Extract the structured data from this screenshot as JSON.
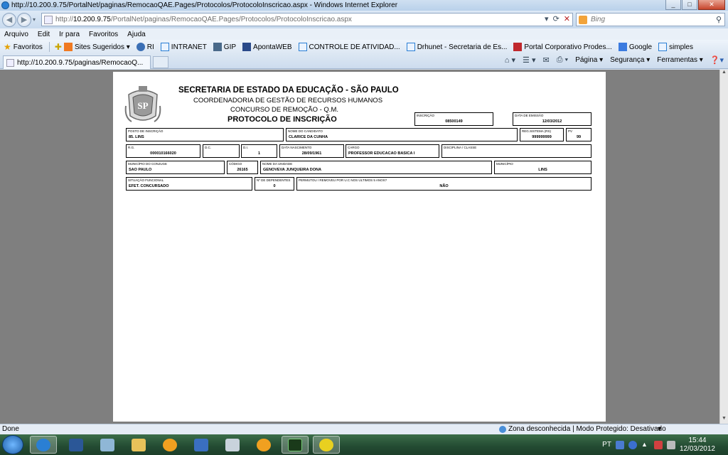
{
  "window": {
    "title": "http://10.200.9.75/PortalNet/paginas/RemocaoQAE.Pages/Protocolos/ProtocoloInscricao.aspx - Windows Internet Explorer"
  },
  "address": {
    "url_prefix": "http://",
    "url_host": "10.200.9.75",
    "url_path": "/PortalNet/paginas/RemocaoQAE.Pages/Protocolos/ProtocoloInscricao.aspx",
    "search_placeholder": "Bing"
  },
  "menu": [
    "Arquivo",
    "Edit",
    "Ir para",
    "Favoritos",
    "Ajuda"
  ],
  "favorites": {
    "label": "Favoritos",
    "items": [
      {
        "label": "Sites Sugeridos ▾",
        "icon": "suggested-sites-icon",
        "color": "#f07a22"
      },
      {
        "label": "RI",
        "icon": "ri-icon",
        "color": "#3b6fb5"
      },
      {
        "label": "INTRANET",
        "icon": "ie-page-icon",
        "color": "#2a7fd4"
      },
      {
        "label": "GIP",
        "icon": "gip-icon",
        "color": "#4a6a8a"
      },
      {
        "label": "ApontaWEB",
        "icon": "apontaweb-icon",
        "color": "#2a4a8a"
      },
      {
        "label": "CONTROLE DE ATIVIDAD...",
        "icon": "ie-page-icon",
        "color": "#2a7fd4"
      },
      {
        "label": "Drhunet - Secretaria de Es...",
        "icon": "ie-page-icon",
        "color": "#2a7fd4"
      },
      {
        "label": "Portal Corporativo Prodes...",
        "icon": "portal-icon",
        "color": "#c0282d"
      },
      {
        "label": "Google",
        "icon": "google-icon",
        "color": "#3b7be0"
      },
      {
        "label": "simples",
        "icon": "ie-page-icon",
        "color": "#2a7fd4"
      }
    ]
  },
  "tab": {
    "label": "http://10.200.9.75/paginas/RemocaoQ..."
  },
  "commandbar": {
    "page": "Página ▾",
    "security": "Segurança ▾",
    "tools": "Ferramentas ▾"
  },
  "document": {
    "title1": "SECRETARIA DE ESTADO DA EDUCAÇÃO - SÃO PAULO",
    "title2": "COORDENADORIA DE GESTÃO DE RECURSOS HUMANOS",
    "title3": "CONCURSO DE REMOÇÃO - Q.M.",
    "title4": "PROTOCOLO DE INSCRIÇÃO",
    "logo_text": "SP",
    "fields": {
      "inscricao": {
        "label": "INSCRIÇÃO",
        "value": "08500149"
      },
      "data_emissao": {
        "label": "DATA DE EMISSÃO",
        "value": "12/03/2012"
      },
      "posto": {
        "label": "POSTO DE INSCRIÇÃO",
        "value": "85. LINS"
      },
      "candidato": {
        "label": "NOME DO CANDIDATO",
        "value": "CLARICE DA CUNHA"
      },
      "reg_sistema": {
        "label": "REG.SISTEMA (RS)",
        "value": "999999999"
      },
      "pv": {
        "label": "PV",
        "value": "99"
      },
      "rg": {
        "label": "R.G.",
        "value": "000010166020"
      },
      "dc": {
        "label": "D.C.",
        "value": ""
      },
      "di": {
        "label": "D.I.",
        "value": "1"
      },
      "nascimento": {
        "label": "DATA NASCIMENTO",
        "value": "28/09/1961"
      },
      "cargo": {
        "label": "CARGO",
        "value": "PROFESSOR EDUCACAO BASICA I"
      },
      "disciplina": {
        "label": "DISCIPLINA / CLASSE",
        "value": ""
      },
      "municipio_conjuge": {
        "label": "MUNICÍPIO DO CONJUGE",
        "value": "SAO PAULO"
      },
      "codigo": {
        "label": "CÓDIGO",
        "value": "26165"
      },
      "unidade": {
        "label": "NOME DA UNIDADE",
        "value": "GENOVEVA JUNQUEIRA DONA"
      },
      "municipio": {
        "label": "MUNICÍPIO",
        "value": "LINS"
      },
      "situacao": {
        "label": "SITUAÇÃO FUNCIONAL",
        "value": "EFET. CONCURSADO"
      },
      "dependentes": {
        "label": "Nº DE DEPENDENTES",
        "value": "0"
      },
      "permutou": {
        "label": "PERMUTOU / REMOVEU POR U.C NOS ÚLTIMOS 5 ANOS?",
        "value": "NÃO"
      }
    }
  },
  "status": {
    "left": "Done",
    "zone": "Zona desconhecida | Modo Protegido: Desativado",
    "zoom": "▾"
  },
  "taskbar": {
    "lang": "PT",
    "time": "15:44",
    "date": "12/03/2012"
  }
}
